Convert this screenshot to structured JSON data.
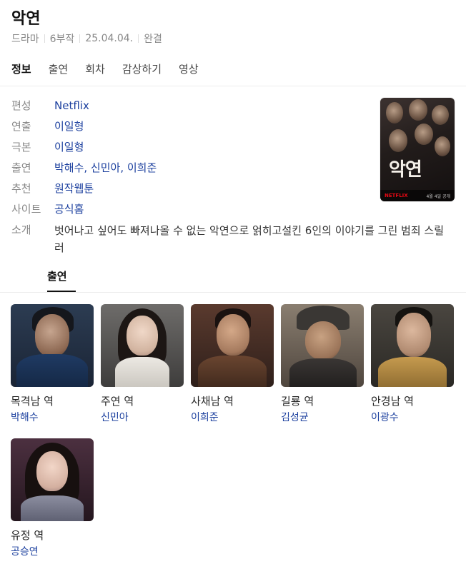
{
  "header": {
    "title": "악연",
    "meta": [
      "드라마",
      "6부작",
      "25.04.04.",
      "완결"
    ]
  },
  "tabs": [
    {
      "label": "정보",
      "active": true
    },
    {
      "label": "출연",
      "active": false
    },
    {
      "label": "회차",
      "active": false
    },
    {
      "label": "감상하기",
      "active": false
    },
    {
      "label": "영상",
      "active": false
    }
  ],
  "info": [
    {
      "label": "편성",
      "value": "Netflix"
    },
    {
      "label": "연출",
      "value": "이일형"
    },
    {
      "label": "극본",
      "value": "이일형"
    },
    {
      "label": "출연",
      "value": "박해수, 신민아, 이희준"
    },
    {
      "label": "추천",
      "value": "원작웹툰"
    },
    {
      "label": "사이트",
      "value": "공식홈"
    },
    {
      "label": "소개",
      "value": "벗어나고 싶어도 빠져나올 수 없는 악연으로 얽히고설킨 6인의 이야기를 그린 범죄 스릴러"
    }
  ],
  "poster": {
    "title_art": "악연",
    "service": "NETFLIX",
    "date": "4월 4일 공개",
    "brand_color": "#e50914"
  },
  "cast_section": {
    "tab_label": "출연"
  },
  "cast": [
    {
      "role": "목격남 역",
      "actor": "박해수"
    },
    {
      "role": "주연 역",
      "actor": "신민아"
    },
    {
      "role": "사채남 역",
      "actor": "이희준"
    },
    {
      "role": "길룡 역",
      "actor": "김성균"
    },
    {
      "role": "안경남 역",
      "actor": "이광수"
    },
    {
      "role": "유정 역",
      "actor": "공승연"
    }
  ],
  "colors": {
    "link": "#1b3f9e",
    "label": "#888888"
  }
}
